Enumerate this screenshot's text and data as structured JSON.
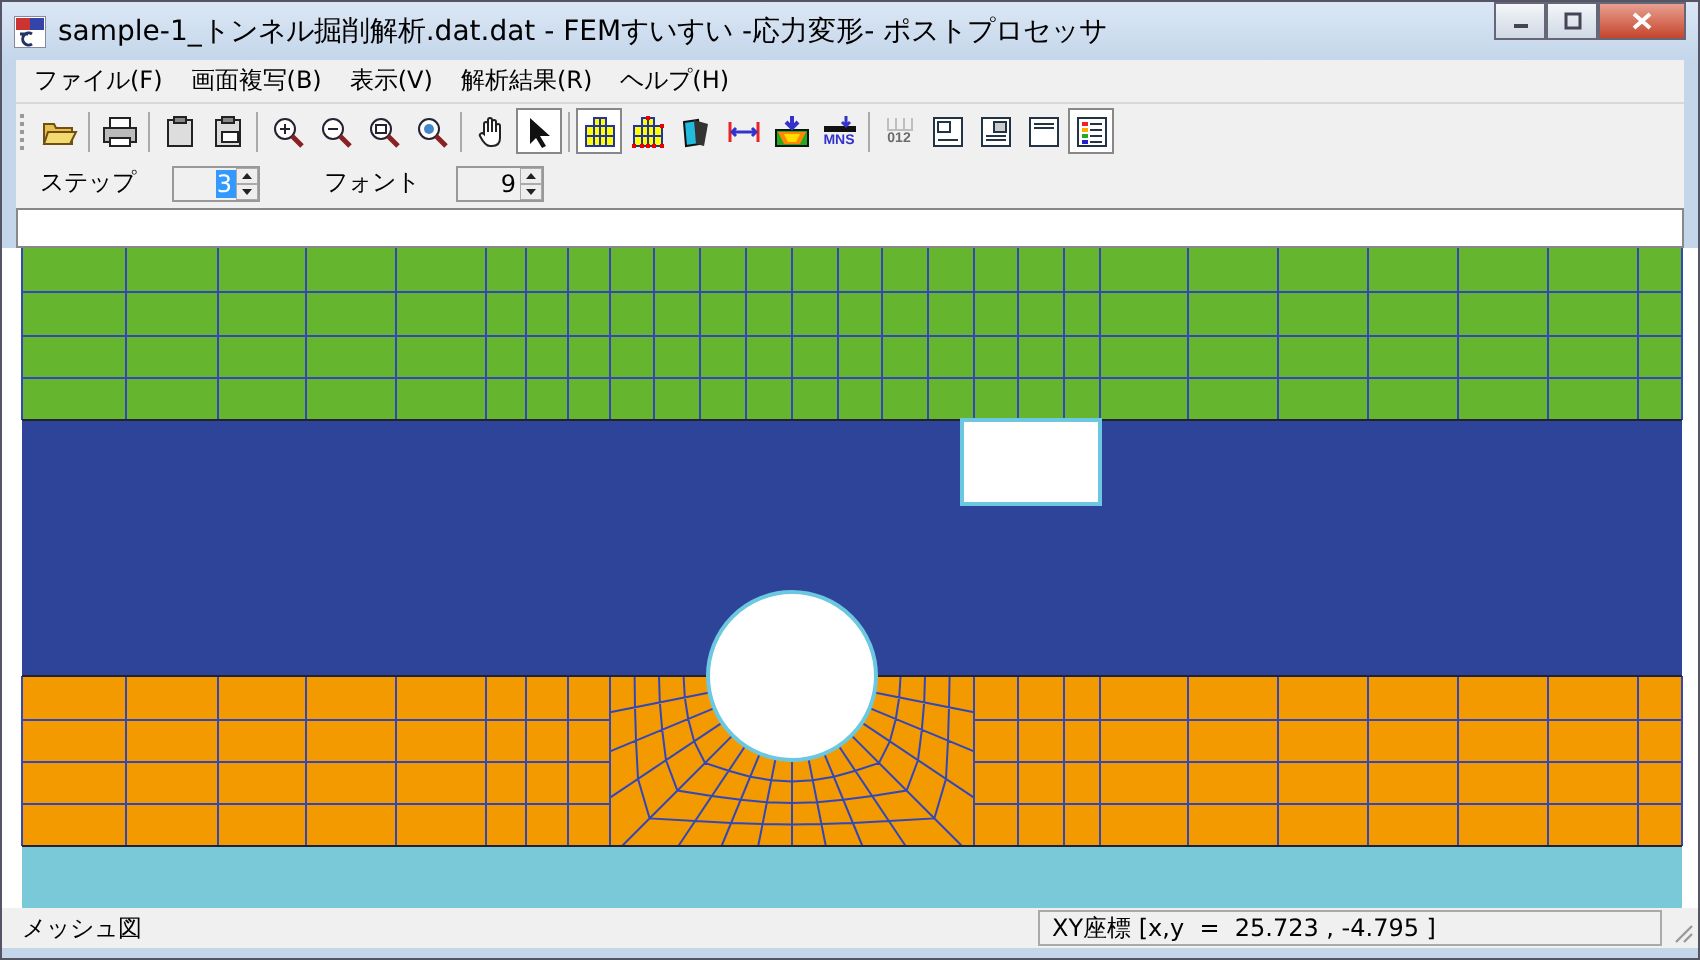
{
  "window": {
    "title": "sample-1_トンネル掘削解析.dat.dat - FEMすいすい -応力変形- ポストプロセッサ"
  },
  "menu": [
    "ファイル(F)",
    "画面複写(B)",
    "表示(V)",
    "解析結果(R)",
    "ヘルプ(H)"
  ],
  "toolbar": [
    [
      {
        "kind": "open",
        "selected": false,
        "disabled": false
      }
    ],
    [
      {
        "kind": "print",
        "selected": false,
        "disabled": false
      }
    ],
    [
      {
        "kind": "copy",
        "selected": false,
        "disabled": false
      },
      {
        "kind": "copy-print",
        "selected": false,
        "disabled": false
      }
    ],
    [
      {
        "kind": "zoom-in",
        "selected": false,
        "disabled": false
      },
      {
        "kind": "zoom-out",
        "selected": false,
        "disabled": false
      },
      {
        "kind": "zoom-box",
        "selected": false,
        "disabled": false
      },
      {
        "kind": "zoom-all",
        "selected": false,
        "disabled": false
      }
    ],
    [
      {
        "kind": "hand",
        "selected": false,
        "disabled": false
      },
      {
        "kind": "pointer",
        "selected": true,
        "disabled": false
      }
    ],
    [
      {
        "kind": "grid",
        "selected": true,
        "disabled": false
      },
      {
        "kind": "grid-nodes",
        "selected": false,
        "disabled": false
      },
      {
        "kind": "layers",
        "selected": false,
        "disabled": false
      },
      {
        "kind": "dimension",
        "selected": false,
        "disabled": false
      },
      {
        "kind": "contour",
        "selected": false,
        "disabled": false
      },
      {
        "kind": "load",
        "selected": false,
        "disabled": false,
        "label": "MNS"
      }
    ],
    [
      {
        "kind": "numbers",
        "selected": false,
        "disabled": true,
        "label": "012"
      },
      {
        "kind": "panel-a",
        "selected": false,
        "disabled": false
      },
      {
        "kind": "panel-b",
        "selected": false,
        "disabled": false
      },
      {
        "kind": "panel-c",
        "selected": false,
        "disabled": false
      },
      {
        "kind": "legend",
        "selected": true,
        "disabled": false
      }
    ]
  ],
  "spinners": [
    {
      "label": "ステップ",
      "value": "3",
      "highlighted": true
    },
    {
      "label": "フォント",
      "value": "9",
      "highlighted": false
    }
  ],
  "status_bar": {
    "left": "メッシュ図",
    "coordinates": "XY座標 [x,y  =  25.723 , -4.795 ]"
  }
}
